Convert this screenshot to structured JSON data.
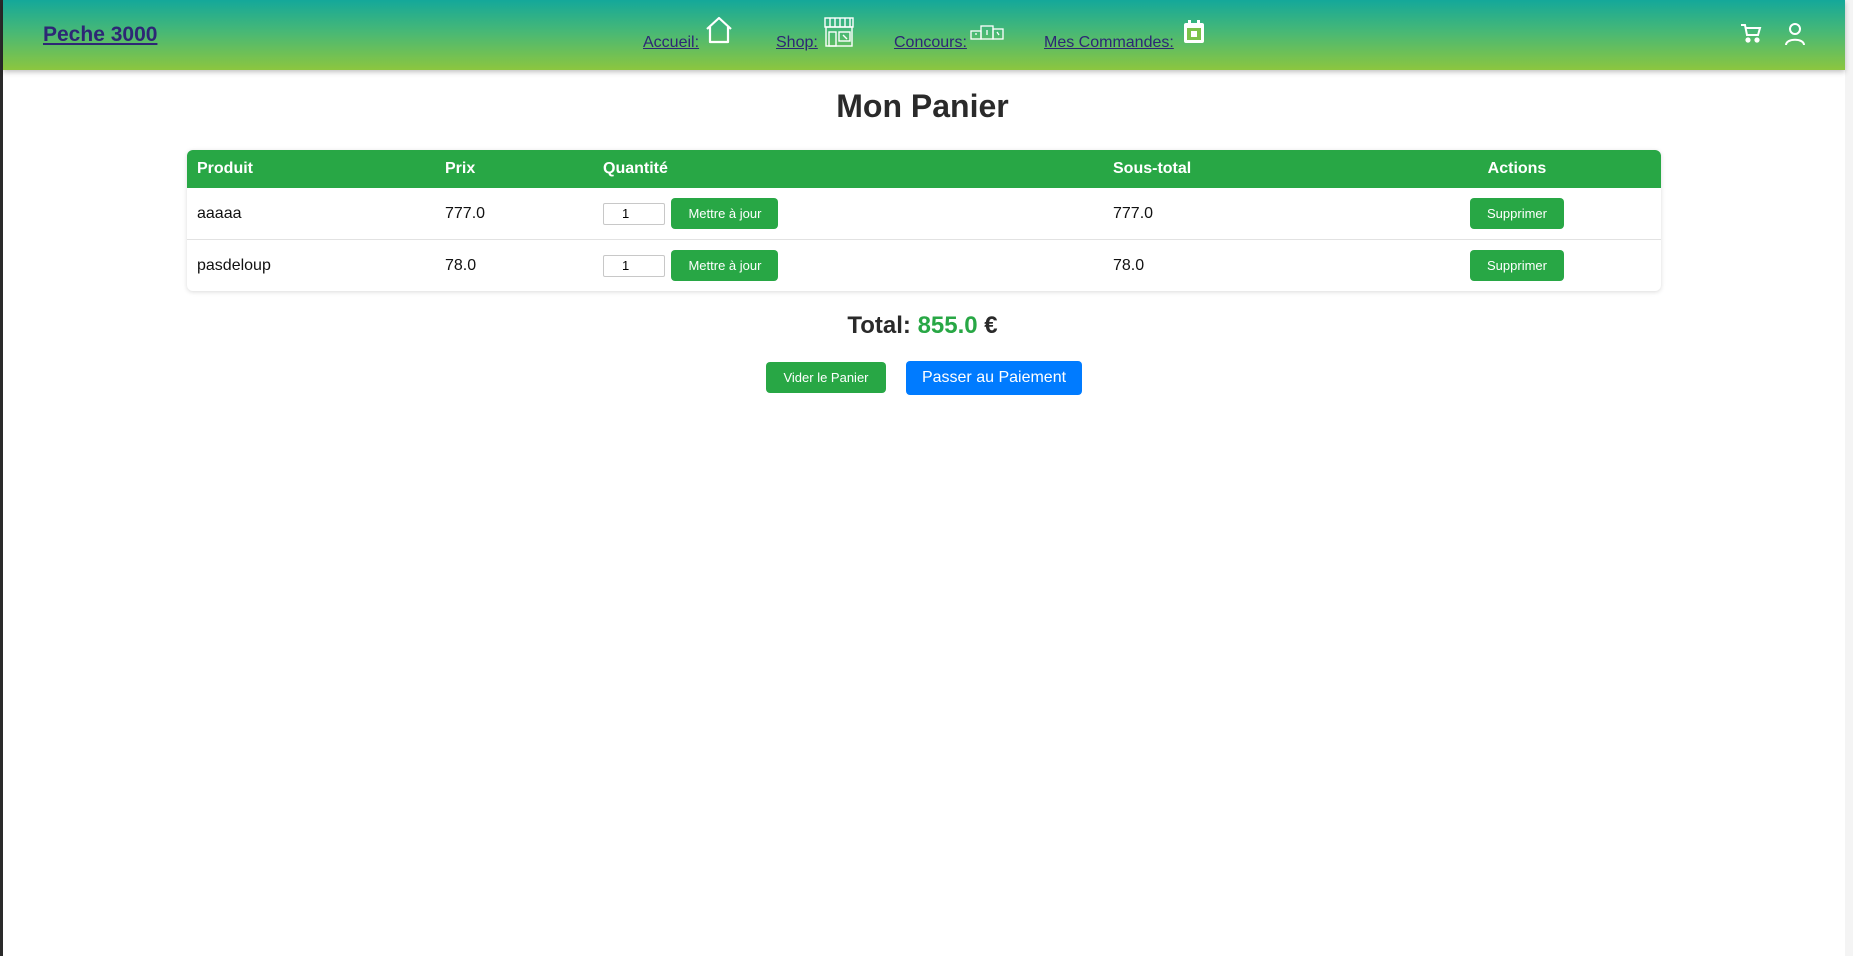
{
  "header": {
    "brand": "Peche 3000",
    "nav": [
      {
        "label": "Accueil:",
        "icon": "home-icon"
      },
      {
        "label": "Shop:",
        "icon": "shop-icon"
      },
      {
        "label": "Concours:",
        "icon": "podium-icon"
      },
      {
        "label": "Mes Commandes:",
        "icon": "calendar-icon"
      }
    ],
    "right_icons": [
      "cart-icon",
      "user-icon"
    ]
  },
  "page": {
    "title": "Mon Panier"
  },
  "cart": {
    "columns": [
      "Produit",
      "Prix",
      "Quantité",
      "Sous-total",
      "Actions"
    ],
    "rows": [
      {
        "product": "aaaaa",
        "price": "777.0",
        "quantity": "1",
        "subtotal": "777.0",
        "update_label": "Mettre à jour",
        "delete_label": "Supprimer"
      },
      {
        "product": "pasdeloup",
        "price": "78.0",
        "quantity": "1",
        "subtotal": "78.0",
        "update_label": "Mettre à jour",
        "delete_label": "Supprimer"
      }
    ]
  },
  "summary": {
    "total_label": "Total:",
    "total_value": "855.0",
    "currency": "€",
    "empty_label": "Vider le Panier",
    "pay_label": "Passer au Paiement"
  },
  "colors": {
    "primary_green": "#28a745",
    "primary_blue": "#007bff",
    "link_color": "#2d2775"
  }
}
